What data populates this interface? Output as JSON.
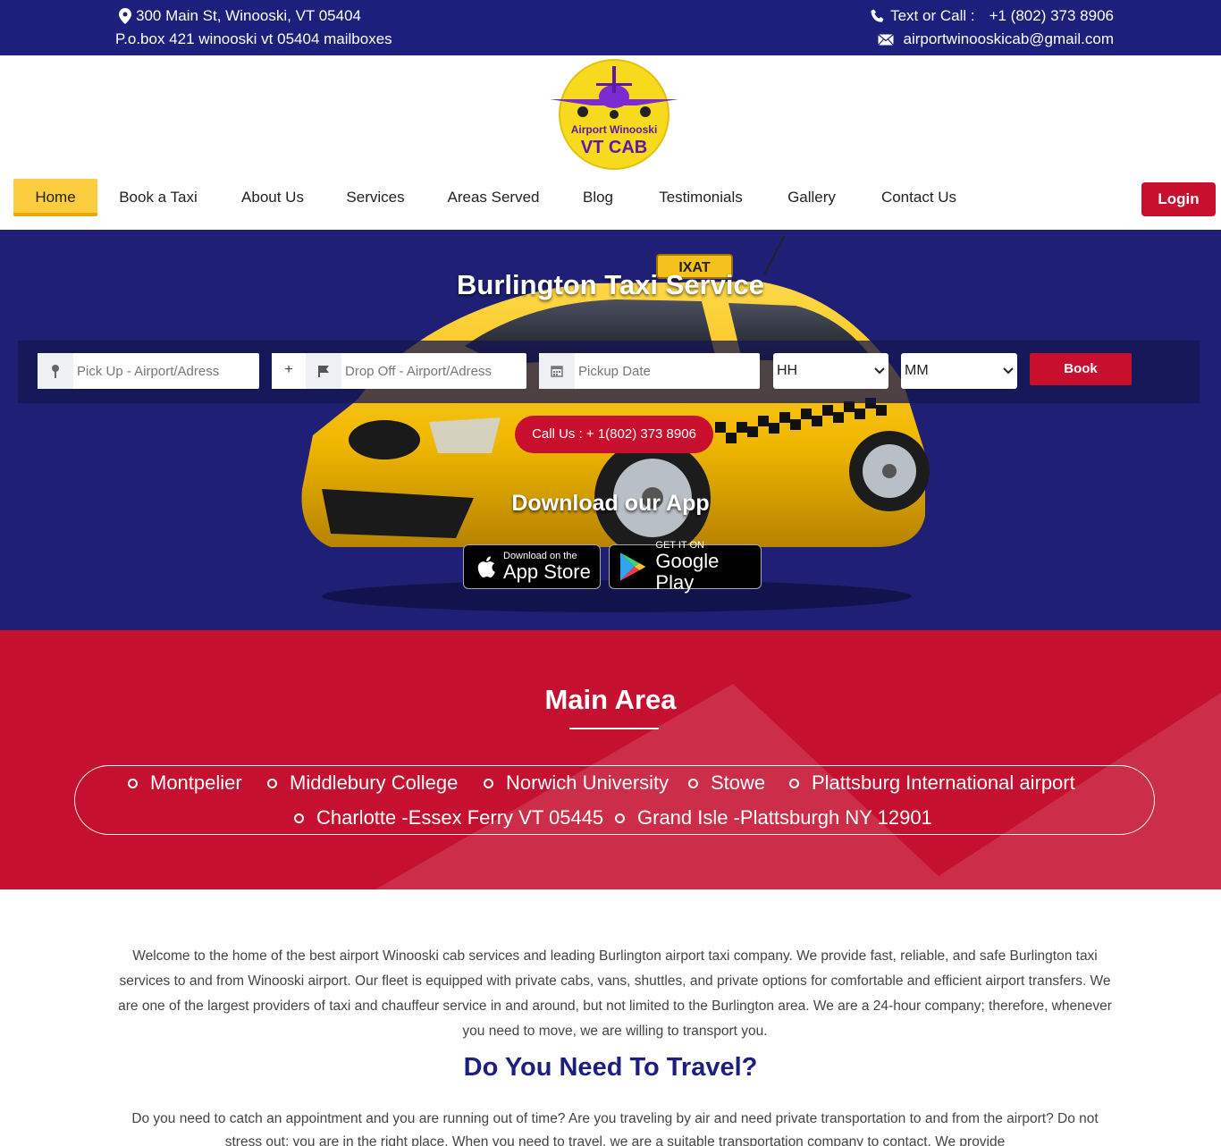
{
  "topbar": {
    "address": "300 Main St, Winooski, VT 05404",
    "pobox": "P.o.box 421 winooski vt 05404 mailboxes",
    "call_label": "Text or Call :",
    "phone": "+1 (802) 373 8906",
    "email": "airportwinooskicab@gmail.com",
    "icons": [
      "map-pin-icon",
      "phone-icon",
      "mail-icon"
    ]
  },
  "logo": {
    "line1": "Airport Winooski",
    "line2": "VT CAB"
  },
  "nav": {
    "items": [
      {
        "label": "Home",
        "active": true
      },
      {
        "label": "Book a Taxi"
      },
      {
        "label": "About Us"
      },
      {
        "label": "Services"
      },
      {
        "label": "Areas Served"
      },
      {
        "label": "Blog"
      },
      {
        "label": "Testimonials"
      },
      {
        "label": "Gallery"
      },
      {
        "label": "Contact Us"
      }
    ],
    "login": "Login"
  },
  "hero": {
    "title": "Burlington Taxi Service",
    "taxi_sign": "IXAT",
    "pickup_placeholder": "Pick Up - Airport/Adress",
    "plus": "+",
    "dropoff_placeholder": "Drop Off  - Airport/Adress",
    "date_placeholder": "Pickup Date",
    "hour_value": "HH",
    "minute_value": "MM",
    "book": "Book",
    "call": "Call Us : + 1(802) 373 8906",
    "download_title": "Download our App",
    "appstore_small": "Download on the",
    "appstore_big": "App Store",
    "googleplay_small": "GET IT ON",
    "googleplay_big": "Google Play"
  },
  "main_area": {
    "title": "Main Area",
    "places": [
      "Montpelier",
      "Middlebury College",
      "Norwich University",
      "Stowe",
      "Plattsburg International airport",
      "Charlotte -Essex Ferry VT 05445",
      "Grand Isle -Plattsburgh NY 12901"
    ]
  },
  "content": {
    "intro": "Welcome to the home of the best airport Winooski cab services and leading Burlington airport taxi company. We provide fast, reliable, and safe Burlington taxi services to and from Winooski airport. Our fleet is equipped with private cabs, vans, shuttles, and private options for comfortable and efficient airport transfers. We are one of the largest providers of taxi and chauffeur service in and around, but not limited to the Burlington area. We are a 24-hour company; therefore, whenever you need to move, we are willing to transport you.",
    "heading": "Do You Need To Travel?",
    "para2": "Do you need to catch an appointment and you are running out of time? Are you traveling by air and need private transportation to and from the airport? Do not stress out; you are in the right place. When you need to travel, we are a suitable transportation company to contact. We provide"
  },
  "colors": {
    "navy": "#1c1f7c",
    "red": "#c8102e",
    "yellow": "#fbcd3f"
  }
}
